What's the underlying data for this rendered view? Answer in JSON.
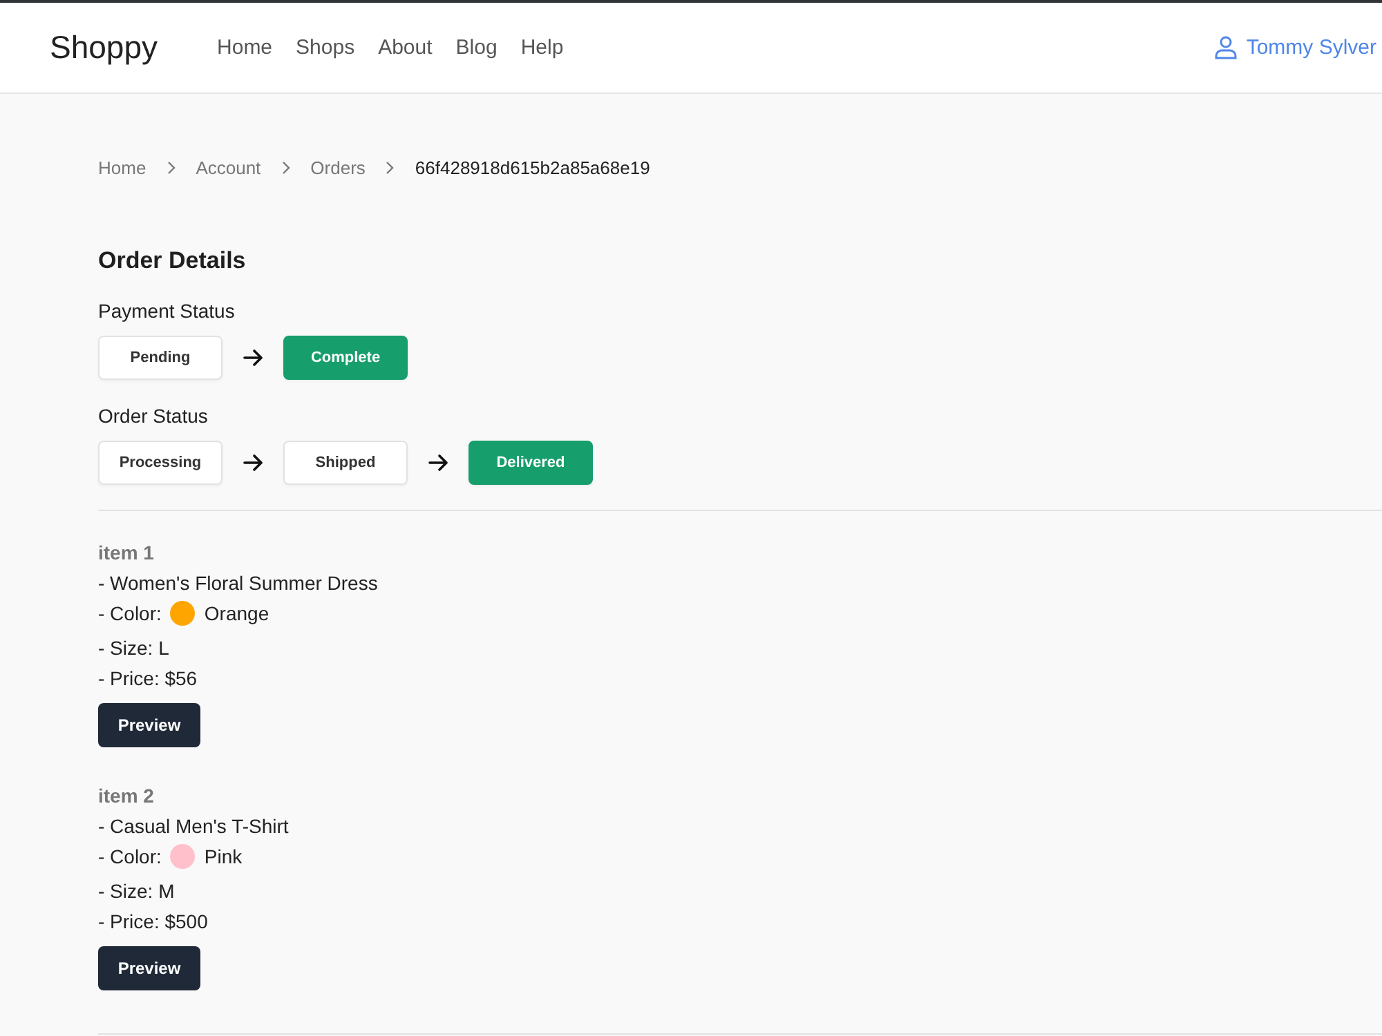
{
  "header": {
    "logo": "Shoppy",
    "nav": [
      "Home",
      "Shops",
      "About",
      "Blog",
      "Help"
    ],
    "user": "Tommy Sylver"
  },
  "breadcrumb": [
    {
      "label": "Home",
      "kind": "link"
    },
    {
      "label": "Account",
      "kind": "link"
    },
    {
      "label": "Orders",
      "kind": "link"
    },
    {
      "label": "66f428918d615b2a85a68e19",
      "kind": "current"
    }
  ],
  "heading": "Order Details",
  "statuses": [
    {
      "label": "Payment Status",
      "steps": [
        {
          "label": "Pending",
          "selected": false
        },
        {
          "label": "Complete",
          "selected": true
        }
      ]
    },
    {
      "label": "Order Status",
      "steps": [
        {
          "label": "Processing",
          "selected": false
        },
        {
          "label": "Shipped",
          "selected": false
        },
        {
          "label": "Delivered",
          "selected": true
        }
      ]
    }
  ],
  "items": [
    {
      "title": "item 1",
      "name": "- Women's Floral Summer Dress",
      "color_label": "- Color:",
      "color": "#ffa500",
      "color_name": "Orange",
      "size": "- Size: L",
      "price": "- Price: $56",
      "button": "Preview"
    },
    {
      "title": "item 2",
      "name": "- Casual Men's T-Shirt",
      "color_label": "- Color:",
      "color": "#ffc0cb",
      "color_name": "Pink",
      "size": "- Size: M",
      "price": "- Price: $500",
      "button": "Preview"
    }
  ]
}
